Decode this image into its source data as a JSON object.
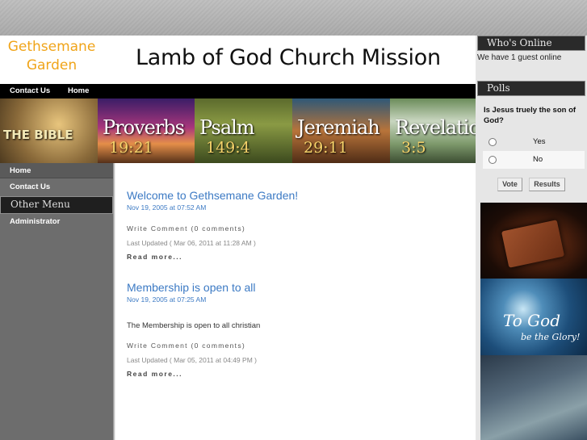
{
  "header": {
    "logo_line1": "Gethsemane",
    "logo_line2": "Garden",
    "site_title": "Lamb of God Church Mission"
  },
  "topnav": {
    "items": [
      {
        "label": "Contact Us"
      },
      {
        "label": "Home"
      }
    ]
  },
  "banner": {
    "panels": [
      {
        "title": "THE BIBLE",
        "number": ""
      },
      {
        "title": "Proverbs",
        "number": "19:21"
      },
      {
        "title": "Psalm",
        "number": "149:4"
      },
      {
        "title": "Jeremiah",
        "number": "29:11"
      },
      {
        "title": "Revelation",
        "number": "3:5"
      }
    ]
  },
  "leftnav": {
    "home": "Home",
    "contact": "Contact Us",
    "other_menu": "Other Menu",
    "admin": "Administrator"
  },
  "articles": [
    {
      "title": "Welcome to Gethsemane Garden!",
      "date": "Nov 19, 2005 at 07:52 AM",
      "text": "",
      "comments": "Write Comment (0 comments)",
      "updated": "Last Updated ( Mar 06, 2011 at 11:28 AM )",
      "read_more": "Read more..."
    },
    {
      "title": "Membership is open to all",
      "date": "Nov 19, 2005 at 07:25 AM",
      "text": "The Membership is open to all christian",
      "comments": "Write Comment (0 comments)",
      "updated": "Last Updated ( Mar 05, 2011 at 04:49 PM )",
      "read_more": "Read more..."
    }
  ],
  "sidebar": {
    "whos_online_title": "Who's Online",
    "whos_online_text": "We have 1 guest online",
    "polls_title": "Polls",
    "poll_question": "Is Jesus truely the son of God?",
    "options": [
      {
        "label": "Yes"
      },
      {
        "label": "No"
      }
    ],
    "vote_label": "Vote",
    "results_label": "Results",
    "image2_text": "To God",
    "image2_sub": "be the Glory!"
  }
}
